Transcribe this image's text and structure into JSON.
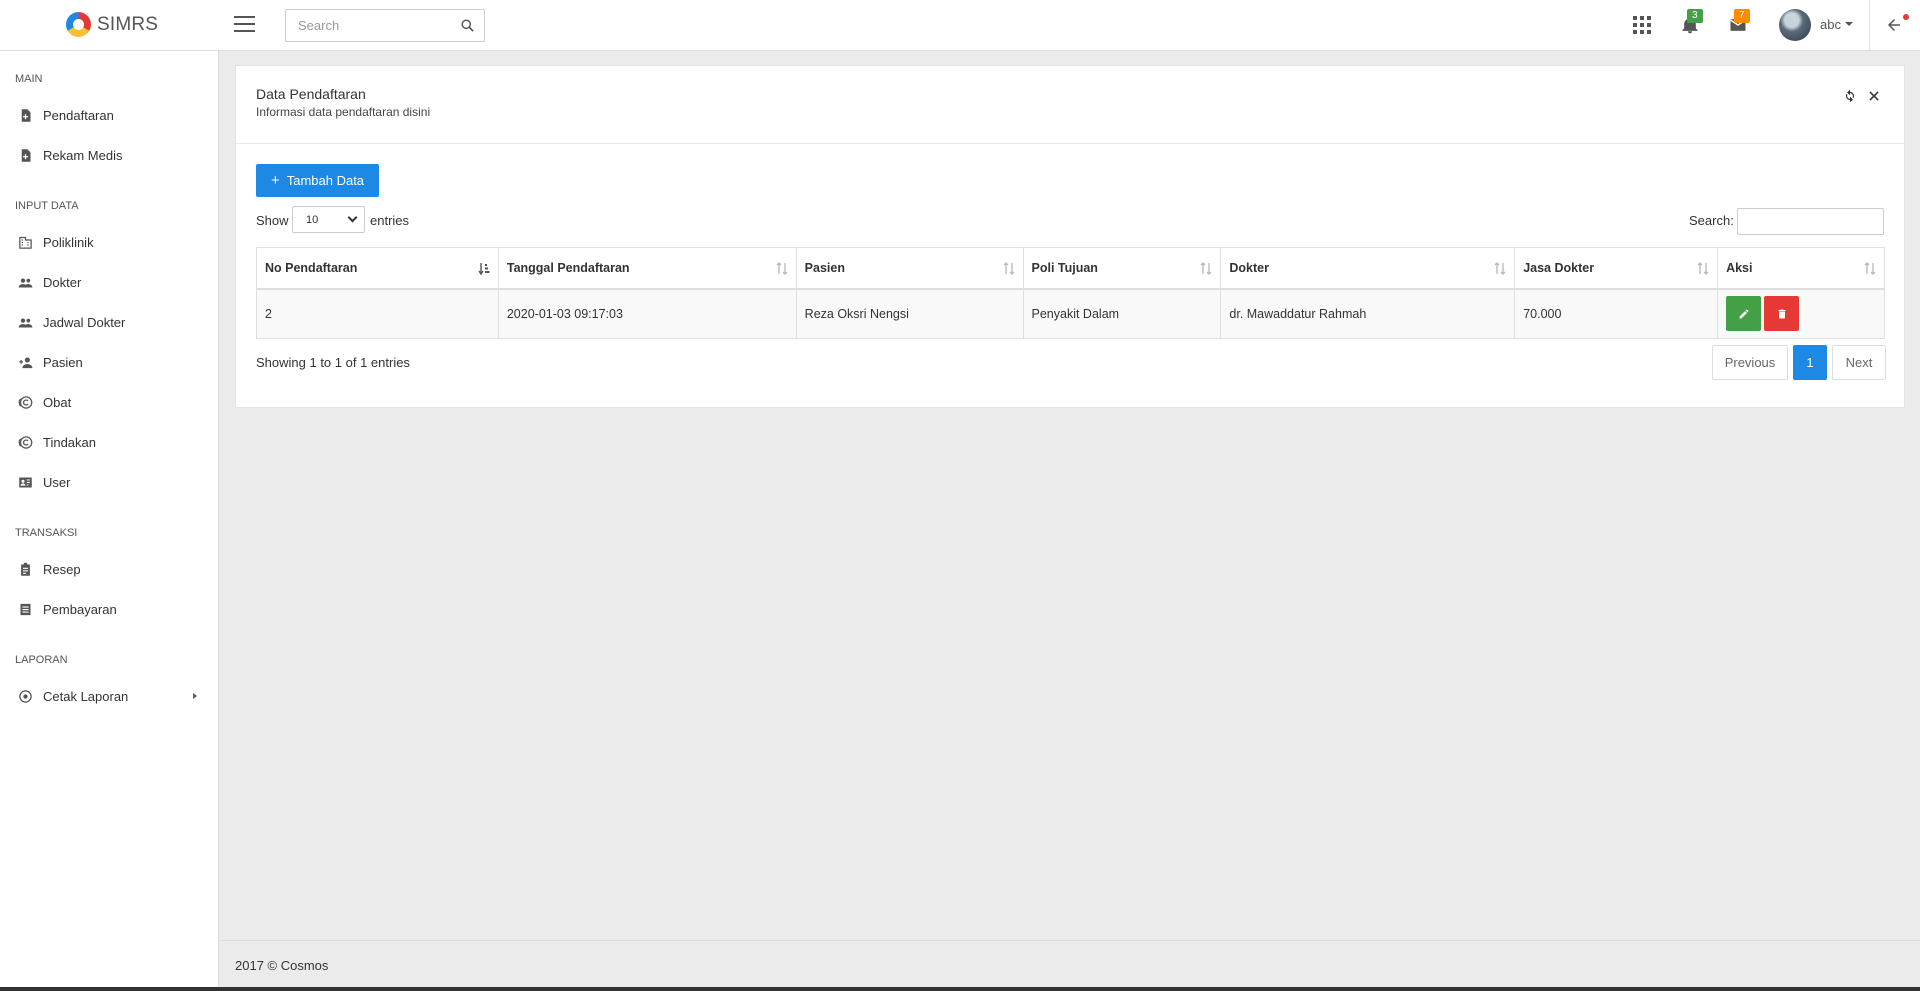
{
  "brand": {
    "name": "SIMRS"
  },
  "topbar": {
    "search_placeholder": "Search",
    "notifications_count": "3",
    "messages_count": "7",
    "user_name": "abc"
  },
  "sidebar": {
    "sections": [
      {
        "header": "MAIN",
        "items": [
          {
            "label": "Pendaftaran",
            "icon": "file-plus-icon"
          },
          {
            "label": "Rekam Medis",
            "icon": "file-plus-icon"
          }
        ]
      },
      {
        "header": "INPUT DATA",
        "items": [
          {
            "label": "Poliklinik",
            "icon": "building-icon"
          },
          {
            "label": "Dokter",
            "icon": "people-icon"
          },
          {
            "label": "Jadwal Dokter",
            "icon": "people-icon"
          },
          {
            "label": "Pasien",
            "icon": "person-add-icon"
          },
          {
            "label": "Obat",
            "icon": "copyright-circle-icon"
          },
          {
            "label": "Tindakan",
            "icon": "copyright-circle-icon"
          },
          {
            "label": "User",
            "icon": "id-card-icon"
          }
        ]
      },
      {
        "header": "TRANSAKSI",
        "items": [
          {
            "label": "Resep",
            "icon": "clipboard-icon"
          },
          {
            "label": "Pembayaran",
            "icon": "list-icon"
          }
        ]
      },
      {
        "header": "LAPORAN",
        "items": [
          {
            "label": "Cetak Laporan",
            "icon": "radio-circle-icon"
          }
        ]
      }
    ]
  },
  "card": {
    "title": "Data Pendaftaran",
    "subtitle": "Informasi data pendaftaran disini",
    "add_button": "Tambah Data",
    "show_label": "Show",
    "entries_value": "10",
    "entries_label": "entries",
    "search_label": "Search:",
    "columns": [
      "No Pendaftaran",
      "Tanggal Pendaftaran",
      "Pasien",
      "Poli Tujuan",
      "Dokter",
      "Jasa Dokter",
      "Aksi"
    ],
    "rows": [
      {
        "no": "2",
        "tanggal": "2020-01-03 09:17:03",
        "pasien": "Reza Oksri Nengsi",
        "poli": "Penyakit Dalam",
        "dokter": "dr. Mawaddatur Rahmah",
        "jasa": "70.000"
      }
    ],
    "info": "Showing 1 to 1 of 1 entries",
    "pagination": {
      "previous": "Previous",
      "current": "1",
      "next": "Next"
    }
  },
  "footer": {
    "text": "2017 © Cosmos"
  },
  "colors": {
    "primary": "#1e88e5",
    "success": "#43a047",
    "danger": "#e53935",
    "warning": "#fb8c00"
  }
}
